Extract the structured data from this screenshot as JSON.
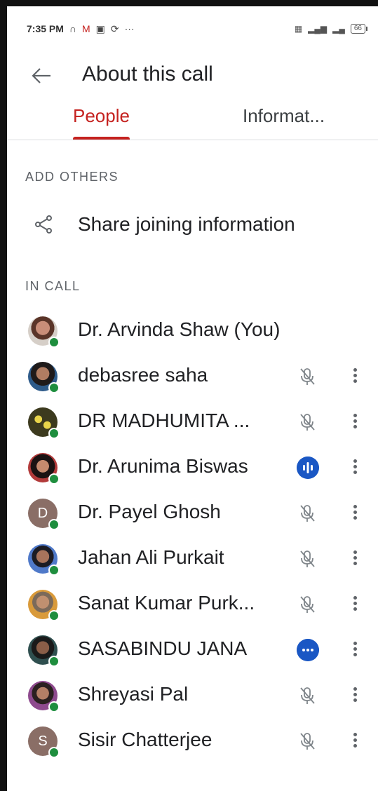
{
  "status_bar": {
    "time": "7:35 PM",
    "more": "···",
    "battery": "66"
  },
  "header": {
    "title": "About this call"
  },
  "tabs": [
    {
      "label": "People",
      "active": true
    },
    {
      "label": "Informat..."
    }
  ],
  "add_others": {
    "label": "ADD OTHERS",
    "share_label": "Share joining information"
  },
  "in_call": {
    "label": "IN CALL",
    "participants": [
      {
        "name": "Dr. Arvinda Shaw (You)",
        "avatar": "photo",
        "status": "none"
      },
      {
        "name": "debasree saha",
        "avatar": "photo",
        "status": "muted"
      },
      {
        "name": "DR MADHUMITA ...",
        "avatar": "photo",
        "status": "muted"
      },
      {
        "name": "Dr. Arunima Biswas",
        "avatar": "photo",
        "status": "speaking"
      },
      {
        "name": "Dr. Payel Ghosh",
        "avatar": "D",
        "status": "muted"
      },
      {
        "name": "Jahan Ali Purkait",
        "avatar": "photo",
        "status": "muted"
      },
      {
        "name": "Sanat Kumar Purk...",
        "avatar": "photo",
        "status": "muted"
      },
      {
        "name": "SASABINDU JANA",
        "avatar": "photo",
        "status": "unmuted"
      },
      {
        "name": "Shreyasi Pal",
        "avatar": "photo",
        "status": "muted"
      },
      {
        "name": "Sisir Chatterjee",
        "avatar": "S",
        "status": "muted"
      }
    ]
  },
  "colors": {
    "accent": "#c5221f",
    "speaking": "#1a57c4",
    "presence": "#1e8e3e"
  }
}
